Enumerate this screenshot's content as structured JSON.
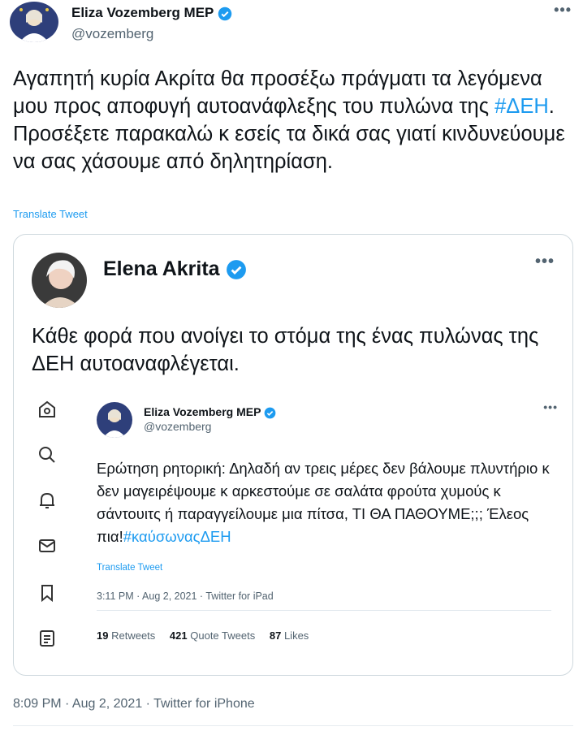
{
  "main": {
    "author": "Eliza Vozemberg MEP",
    "handle": "@vozemberg",
    "text_before_hash": "Αγαπητή κυρία Ακρίτα θα προσέξω πράγματι τα λεγόμενα μου προς αποφυγή αυτοανάφλεξης του πυλώνα της ",
    "hashtag": "#ΔΕΗ",
    "text_after_hash": ". Προσέξετε παρακαλώ κ εσείς τα δικά σας γιατί κινδυνεύουμε να σας χάσουμε από δηλητηρίαση.",
    "translate": "Translate Tweet",
    "timestamp": "8:09 PM · Aug 2, 2021 · Twitter for iPhone",
    "more_icon": "more-dots-icon"
  },
  "quote": {
    "author": "Elena Akrita",
    "text": "Κάθε φορά που ανοίγει το στόμα της ένας πυλώνας της ΔΕΗ αυτοαναφλέγεται."
  },
  "inner": {
    "author": "Eliza Vozemberg MEP",
    "handle": "@vozemberg",
    "text_main": "Ερώτηση ρητορική: Δηλαδή αν τρεις μέρες δεν βάλουμε πλυντήριο κ δεν μαγειρέψουμε κ αρκεστούμε σε σαλάτα φρούτα χυμούς κ σάντουιτς ή παραγγείλουμε μια πίτσα, ΤΙ ΘΑ ΠΑΘΟΥΜΕ;;; Έλεος πια!",
    "hashtag": "#καύσωναςΔΕΗ",
    "translate": "Translate Tweet",
    "timestamp": "3:11 PM · Aug 2, 2021 · Twitter for iPad",
    "retweets_count": "19",
    "retweets_label": "Retweets",
    "quotes_count": "421",
    "quotes_label": "Quote Tweets",
    "likes_count": "87",
    "likes_label": "Likes"
  },
  "sidebar_icons": [
    "home-icon",
    "search-icon",
    "notifications-bell-icon",
    "messages-envelope-icon",
    "bookmark-icon",
    "lists-icon"
  ],
  "colors": {
    "accent": "#1d9bf0",
    "text": "#0f1419",
    "muted": "#536471",
    "border": "#cfd9de"
  }
}
